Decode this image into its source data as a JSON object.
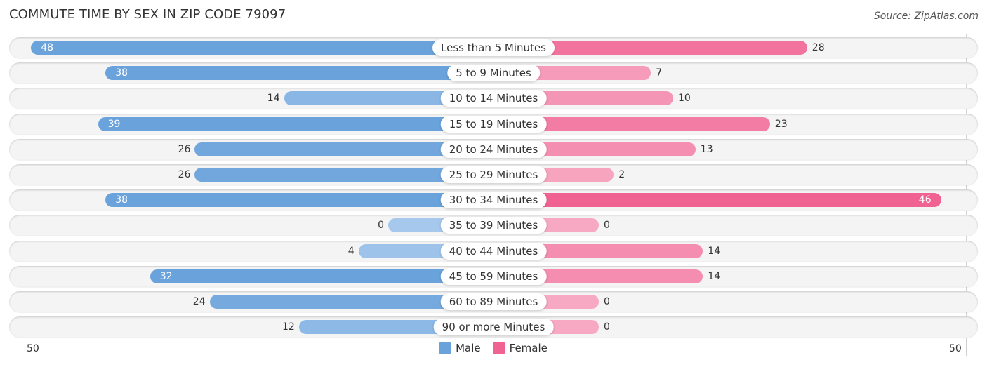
{
  "header": {
    "title": "COMMUTE TIME BY SEX IN ZIP CODE 79097",
    "source": "Source: ZipAtlas.com"
  },
  "colors": {
    "male": "#6aa2dc",
    "male_light": "#a5c8ec",
    "female": "#f06292",
    "female_light": "#f7a8c2",
    "row_bg": "#f4f4f4"
  },
  "chart_data": {
    "type": "bar",
    "orientation": "horizontal-diverging",
    "title": "COMMUTE TIME BY SEX IN ZIP CODE 79097",
    "categories": [
      "Less than 5 Minutes",
      "5 to 9 Minutes",
      "10 to 14 Minutes",
      "15 to 19 Minutes",
      "20 to 24 Minutes",
      "25 to 29 Minutes",
      "30 to 34 Minutes",
      "35 to 39 Minutes",
      "40 to 44 Minutes",
      "45 to 59 Minutes",
      "60 to 89 Minutes",
      "90 or more Minutes"
    ],
    "series": [
      {
        "name": "Male",
        "values": [
          48,
          38,
          14,
          39,
          26,
          26,
          38,
          0,
          4,
          32,
          24,
          12
        ]
      },
      {
        "name": "Female",
        "values": [
          28,
          7,
          10,
          23,
          13,
          2,
          46,
          0,
          14,
          14,
          0,
          0
        ]
      }
    ],
    "xlim": [
      -50,
      50
    ],
    "axis_tick_labels": {
      "left": "50",
      "right": "50"
    },
    "legend": {
      "position": "bottom-center",
      "entries": [
        "Male",
        "Female"
      ]
    },
    "grid": false
  }
}
